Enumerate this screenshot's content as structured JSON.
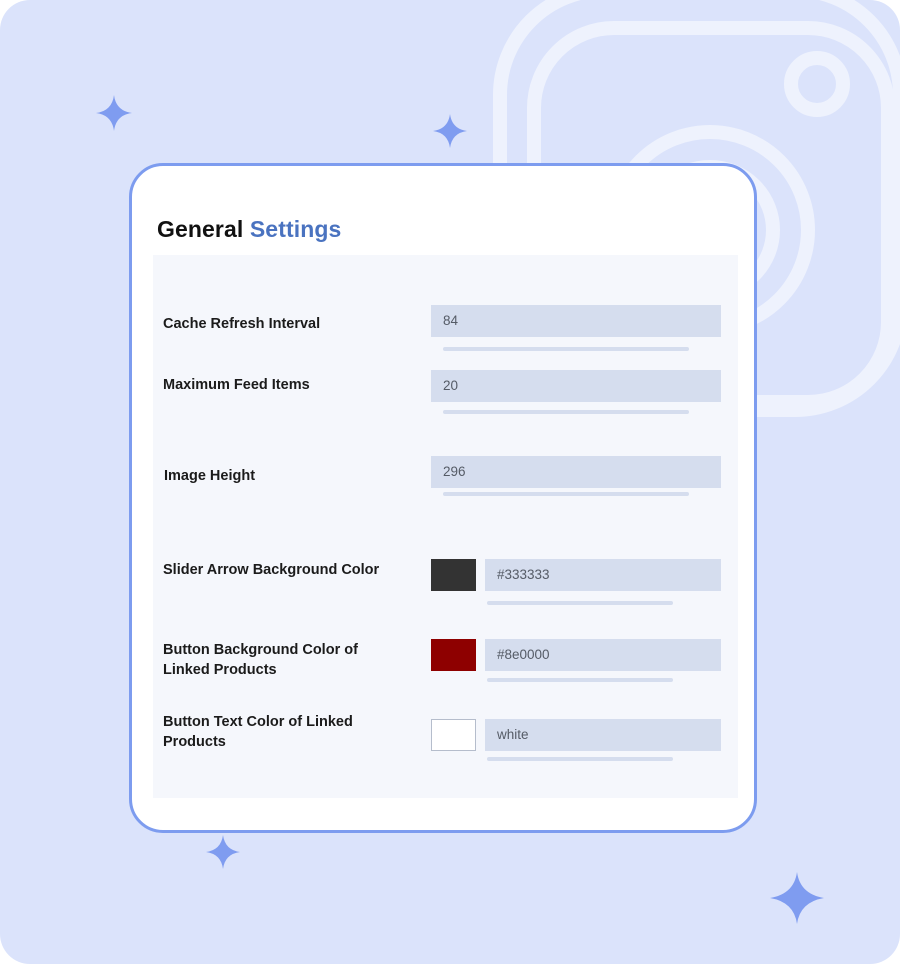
{
  "settings": {
    "title_primary": "General",
    "title_accent": "Settings",
    "rows": [
      {
        "label": "Cache Refresh Interval",
        "value": "84"
      },
      {
        "label": "Maximum Feed Items",
        "value": "20"
      },
      {
        "label": "Image Height",
        "value": "296"
      },
      {
        "label": "Slider Arrow Background Color",
        "value": "#333333",
        "swatch": "#333333"
      },
      {
        "label": "Button Background Color of Linked Products",
        "value": "#8e0000",
        "swatch": "#8e0000"
      },
      {
        "label": "Button Text Color of Linked Products",
        "value": "white",
        "swatch": "#ffffff"
      }
    ]
  },
  "colors": {
    "background": "#dbe3fb",
    "card_border": "#7d9cef",
    "title_accent": "#4a73c0",
    "field_fill": "#d5ddee",
    "sparkle": "#7f9cf0"
  },
  "icons": {
    "background_logo": "camera-outline-icon",
    "sparkles": "four-point-star-icon"
  }
}
